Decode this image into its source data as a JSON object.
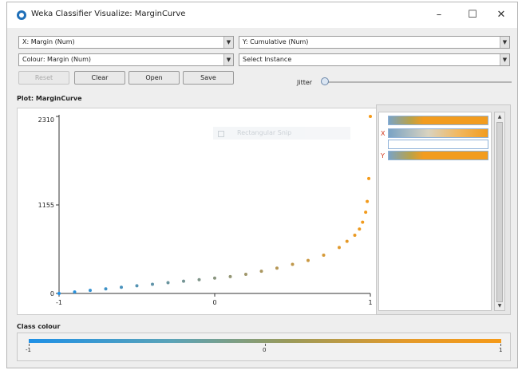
{
  "window": {
    "title": "Weka Classifier Visualize: MarginCurve",
    "minimize": "–",
    "maximize": "☐",
    "close": "✕"
  },
  "controls": {
    "x_axis": "X: Margin (Num)",
    "y_axis": "Y: Cumulative (Num)",
    "colour": "Colour: Margin (Num)",
    "instance": "Select Instance",
    "reset": "Reset",
    "clear": "Clear",
    "open": "Open",
    "save": "Save",
    "jitter": "Jitter"
  },
  "plot": {
    "label": "Plot: MarginCurve",
    "overlay_text": "Rectangular Snip"
  },
  "attributes": {
    "x_marker": "X",
    "y_marker": "Y"
  },
  "class_colour": {
    "label": "Class colour",
    "min": "-1",
    "mid": "0",
    "max": "1"
  },
  "colors": {
    "low": "#1e90e6",
    "high": "#f59a18"
  },
  "chart_data": {
    "type": "scatter",
    "title": "",
    "xlabel": "",
    "ylabel": "",
    "xlim": [
      -1,
      1
    ],
    "ylim": [
      0,
      2310
    ],
    "x_ticks": [
      "-1",
      "0",
      "1"
    ],
    "y_ticks": [
      "0",
      "1155",
      "2310"
    ],
    "x": [
      -1.0,
      -0.9,
      -0.8,
      -0.7,
      -0.6,
      -0.5,
      -0.4,
      -0.3,
      -0.2,
      -0.1,
      0.0,
      0.1,
      0.2,
      0.3,
      0.4,
      0.5,
      0.6,
      0.7,
      0.8,
      0.85,
      0.9,
      0.93,
      0.95,
      0.97,
      0.98,
      0.99,
      1.0
    ],
    "y": [
      0,
      20,
      40,
      60,
      80,
      100,
      120,
      140,
      160,
      180,
      200,
      220,
      250,
      290,
      330,
      380,
      430,
      500,
      600,
      680,
      760,
      840,
      930,
      1060,
      1200,
      1500,
      2310
    ],
    "grid": false,
    "legend": "none"
  }
}
